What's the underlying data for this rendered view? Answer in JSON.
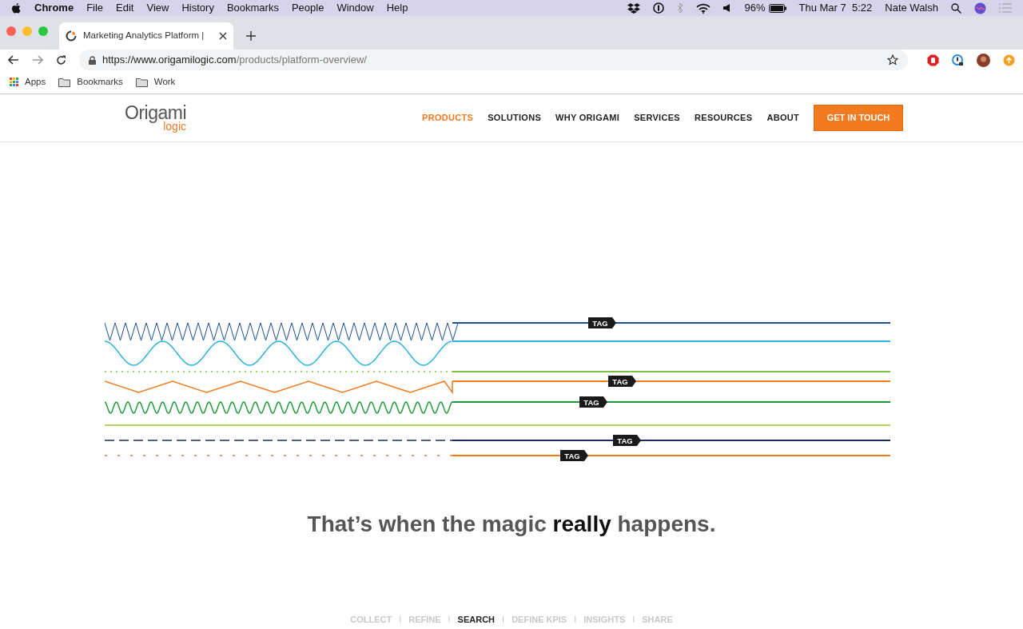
{
  "menu_bar": {
    "app": "Chrome",
    "items": [
      "File",
      "Edit",
      "View",
      "History",
      "Bookmarks",
      "People",
      "Window",
      "Help"
    ],
    "battery": "96%",
    "clock": "Thu Mar 7  5:22",
    "user": "Nate Walsh"
  },
  "tab": {
    "title": "Marketing Analytics Platform |"
  },
  "address_bar": {
    "host": "https://www.origamilogic.com",
    "path": "/products/platform-overview/"
  },
  "bookmarks": [
    {
      "kind": "apps",
      "label": "Apps"
    },
    {
      "kind": "folder",
      "label": "Bookmarks"
    },
    {
      "kind": "folder",
      "label": "Work"
    }
  ],
  "site": {
    "logo": {
      "word": "Origami",
      "sub": "logic"
    },
    "nav": [
      {
        "label": "PRODUCTS",
        "selected": true
      },
      {
        "label": "SOLUTIONS",
        "selected": false
      },
      {
        "label": "WHY ORIGAMI",
        "selected": false
      },
      {
        "label": "SERVICES",
        "selected": false
      },
      {
        "label": "RESOURCES",
        "selected": false
      },
      {
        "label": "ABOUT",
        "selected": false
      }
    ],
    "cta": "GET IN TOUCH"
  },
  "signals": [
    {
      "kind": "zigzag",
      "color": "#1f4e96",
      "tag": "TAG"
    },
    {
      "kind": "sine",
      "color": "#29b4e0"
    },
    {
      "kind": "dotted",
      "color": "#7dc242"
    },
    {
      "kind": "triangle",
      "color": "#f47a20",
      "tag": "TAG"
    },
    {
      "kind": "wave",
      "color": "#1e9a3a",
      "tag": "TAG"
    },
    {
      "kind": "solid",
      "color": "#b5d55a"
    },
    {
      "kind": "dashed",
      "color": "#1c2a5c",
      "tag": "TAG"
    },
    {
      "kind": "sparse",
      "color": "#f47a20",
      "tag": "TAG"
    }
  ],
  "headline": "That’s when the magic **really** happens.",
  "steps": [
    {
      "kind": "step",
      "label": "COLLECT",
      "selected": false
    },
    {
      "kind": "separator",
      "label": "I"
    },
    {
      "kind": "step",
      "label": "REFINE",
      "selected": false
    },
    {
      "kind": "separator",
      "label": "I"
    },
    {
      "kind": "step",
      "label": "SEARCH",
      "selected": true
    },
    {
      "kind": "separator",
      "label": "I"
    },
    {
      "kind": "step",
      "label": "DEFINE KPIS",
      "selected": false
    },
    {
      "kind": "separator",
      "label": "I"
    },
    {
      "kind": "step",
      "label": "INSIGHTS",
      "selected": false
    },
    {
      "kind": "separator",
      "label": "I"
    },
    {
      "kind": "step",
      "label": "SHARE",
      "selected": false
    }
  ]
}
